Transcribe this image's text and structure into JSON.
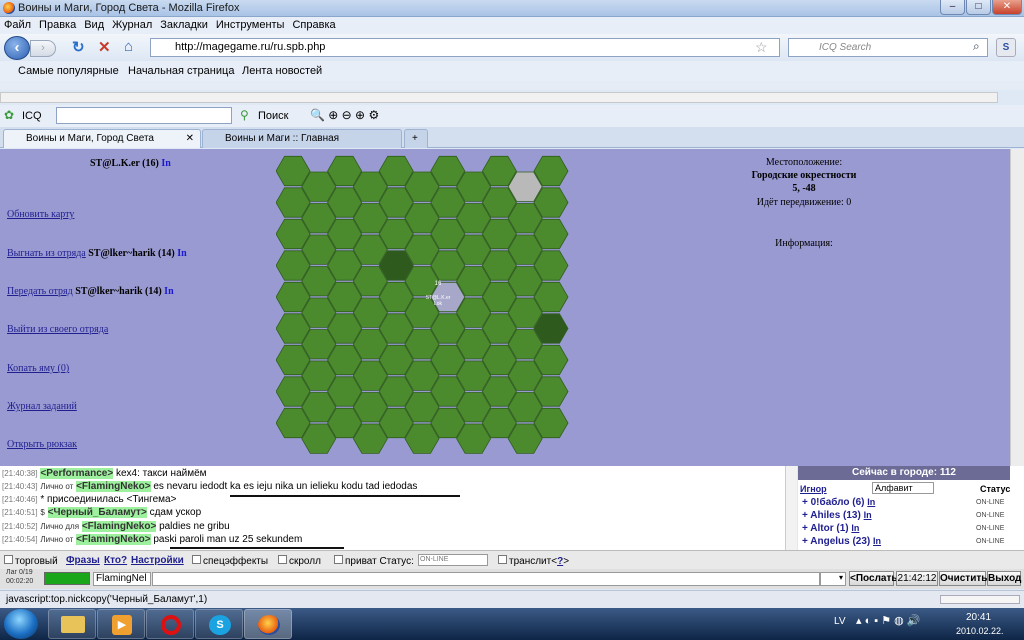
{
  "window": {
    "title": "Воины и Маги, Город Света - Mozilla Firefox"
  },
  "menu": [
    "Файл",
    "Правка",
    "Вид",
    "Журнал",
    "Закладки",
    "Инструменты",
    "Справка"
  ],
  "nav": {
    "url": "http://magegame.ru/ru.spb.php",
    "search_placeholder": "ICQ Search"
  },
  "bookmarks": [
    "Самые популярные",
    "Начальная страница",
    "Лента новостей"
  ],
  "icq": {
    "label": "ICQ",
    "search_label": "Поиск"
  },
  "tabs": [
    {
      "label": "Воины и Маги, Город Света"
    },
    {
      "label": "Воины и Маги :: Главная"
    }
  ],
  "left": {
    "player": "ST@L.K.er (16)",
    "in": "In",
    "refresh": "Обновить карту",
    "kick": "Выгнать из отряда",
    "kick_target": "ST@lker~harik (14)",
    "transfer": "Передать отряд",
    "transfer_target": "ST@lker~harik (14)",
    "leave": "Выйти из своего отряда",
    "dig": "Копать яму (0)",
    "quests": "Журнал заданий",
    "backpack": "Открыть рюкзак"
  },
  "map": {
    "unit_level": "16",
    "unit_name": "ST@L.K.er",
    "unit_tag": "Lok"
  },
  "info": {
    "loc_title": "Местоположение:",
    "loc_name": "Городские окрестности",
    "coords": "5, -48",
    "move": "Идёт передвижение: 0",
    "info_title": "Информация:"
  },
  "chat": [
    {
      "time": "[21:40:38]",
      "prefix": "",
      "nick": "<Performance>",
      "text": "kex4: такси наймём"
    },
    {
      "time": "[21:40:43]",
      "prefix": "Лично от",
      "nick": "<FlamingNeko>",
      "text": "es nevaru iedodt ka es ieju nika un ielieku kodu tad iedodas"
    },
    {
      "time": "[21:40:46]",
      "prefix": "",
      "nick": "",
      "text": "* присоединилась <Тингема>"
    },
    {
      "time": "[21:40:51]",
      "prefix": "$",
      "nick": "<Черный_Баламут>",
      "text": "сдам ускор"
    },
    {
      "time": "[21:40:52]",
      "prefix": "Лично для",
      "nick": "<FlamingNeko>",
      "text": "paldies ne gribu"
    },
    {
      "time": "[21:40:54]",
      "prefix": "Лично от",
      "nick": "<FlamingNeko>",
      "text": "paski paroli man uz 25 sekundem"
    }
  ],
  "online": {
    "header": "Сейчас в городе:",
    "count": "112",
    "ignore": "Игнор",
    "sort": "Алфавит",
    "status_col": "Статус",
    "users": [
      {
        "name": "0!бабло (6)",
        "in": "In",
        "status": "ON-LINE"
      },
      {
        "name": "Ahiles (13)",
        "in": "In",
        "status": "ON-LINE"
      },
      {
        "name": "Altor (1)",
        "in": "In",
        "status": "ON-LINE"
      },
      {
        "name": "Angelus (23)",
        "in": "In",
        "status": "ON-LINE"
      }
    ]
  },
  "options": {
    "trade": "торговый",
    "phrases": "Фразы",
    "who": "Кто?",
    "settings": "Настройки",
    "smiles": "спецэффекты",
    "scroll": "скролл",
    "private": "приват Статус:",
    "status_value": "ON-LINE",
    "translit": "транслит<",
    "q": "?",
    ">": ">"
  },
  "input": {
    "lag": "Лаг 0/19",
    "time": "00:02:20",
    "nick": "FlamingNel",
    "send": "<Послать",
    "clock": "21:42:12",
    "clear": "Очистить",
    "exit": "Выход"
  },
  "status": {
    "text": "javascript:top.nickcopy('Черный_Баламут',1)"
  },
  "taskbar": {
    "lang": "LV",
    "time": "20:41",
    "date": "2010.02.22."
  }
}
